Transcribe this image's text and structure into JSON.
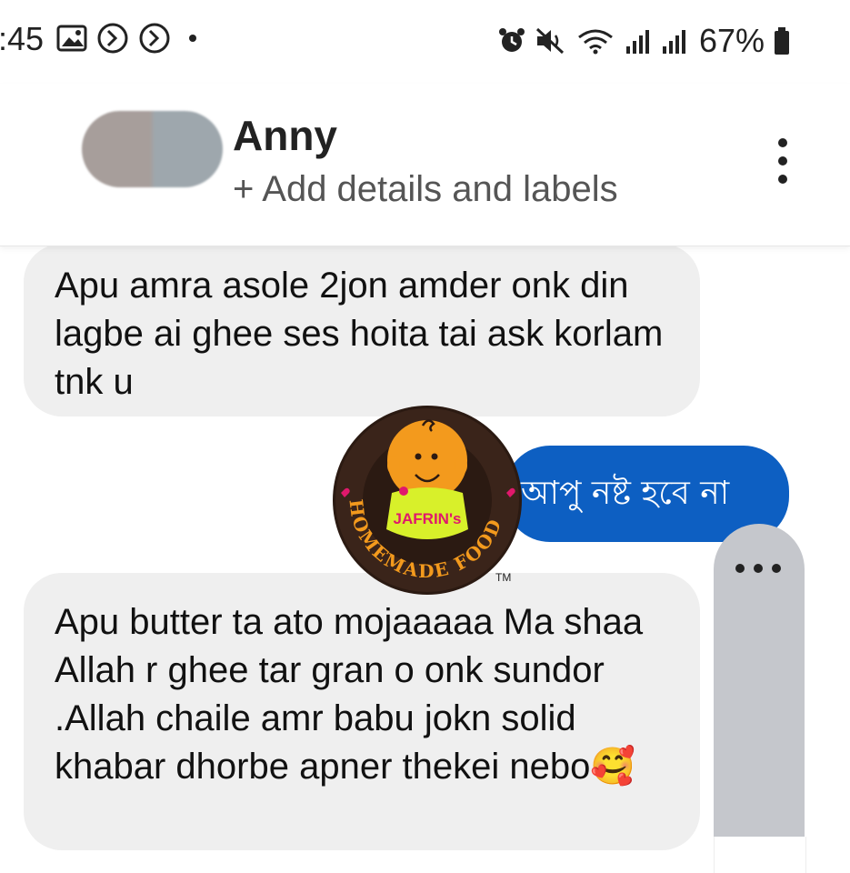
{
  "status_bar": {
    "time": ":45",
    "battery": "67%",
    "icons_left": [
      "gallery-icon",
      "sync-icon",
      "sync-icon",
      "dot-icon"
    ],
    "icons_right": [
      "alarm-icon",
      "mute-icon",
      "wifi-icon",
      "signal-icon",
      "signal-icon",
      "battery-icon"
    ]
  },
  "header": {
    "contact_name": "Anny",
    "add_details": "+ Add details and labels"
  },
  "messages": [
    {
      "direction": "incoming",
      "text": "Apu amra asole 2jon amder onk din lagbe ai ghee ses hoita tai ask korlam tnk u"
    },
    {
      "direction": "outgoing",
      "text": "আপু নষ্ট হবে না"
    },
    {
      "direction": "incoming",
      "text": "Apu butter ta ato mojaaaaa Ma shaa Allah r ghee tar gran o onk sundor .Allah chaile amr babu jokn solid khabar dhorbe apner thekei nebo🥰"
    }
  ],
  "watermark": {
    "brand_top": "JAFRIN's",
    "brand_ring": "HOMEMADE FOOD",
    "tm": "TM"
  },
  "colors": {
    "incoming_bubble": "#efefef",
    "outgoing_bubble": "#0d5fc2",
    "typing_indicator": "#c5c7cc",
    "logo_bg": "#2b1a12",
    "logo_face": "#f39a1d",
    "logo_bib": "#d8f02a"
  }
}
